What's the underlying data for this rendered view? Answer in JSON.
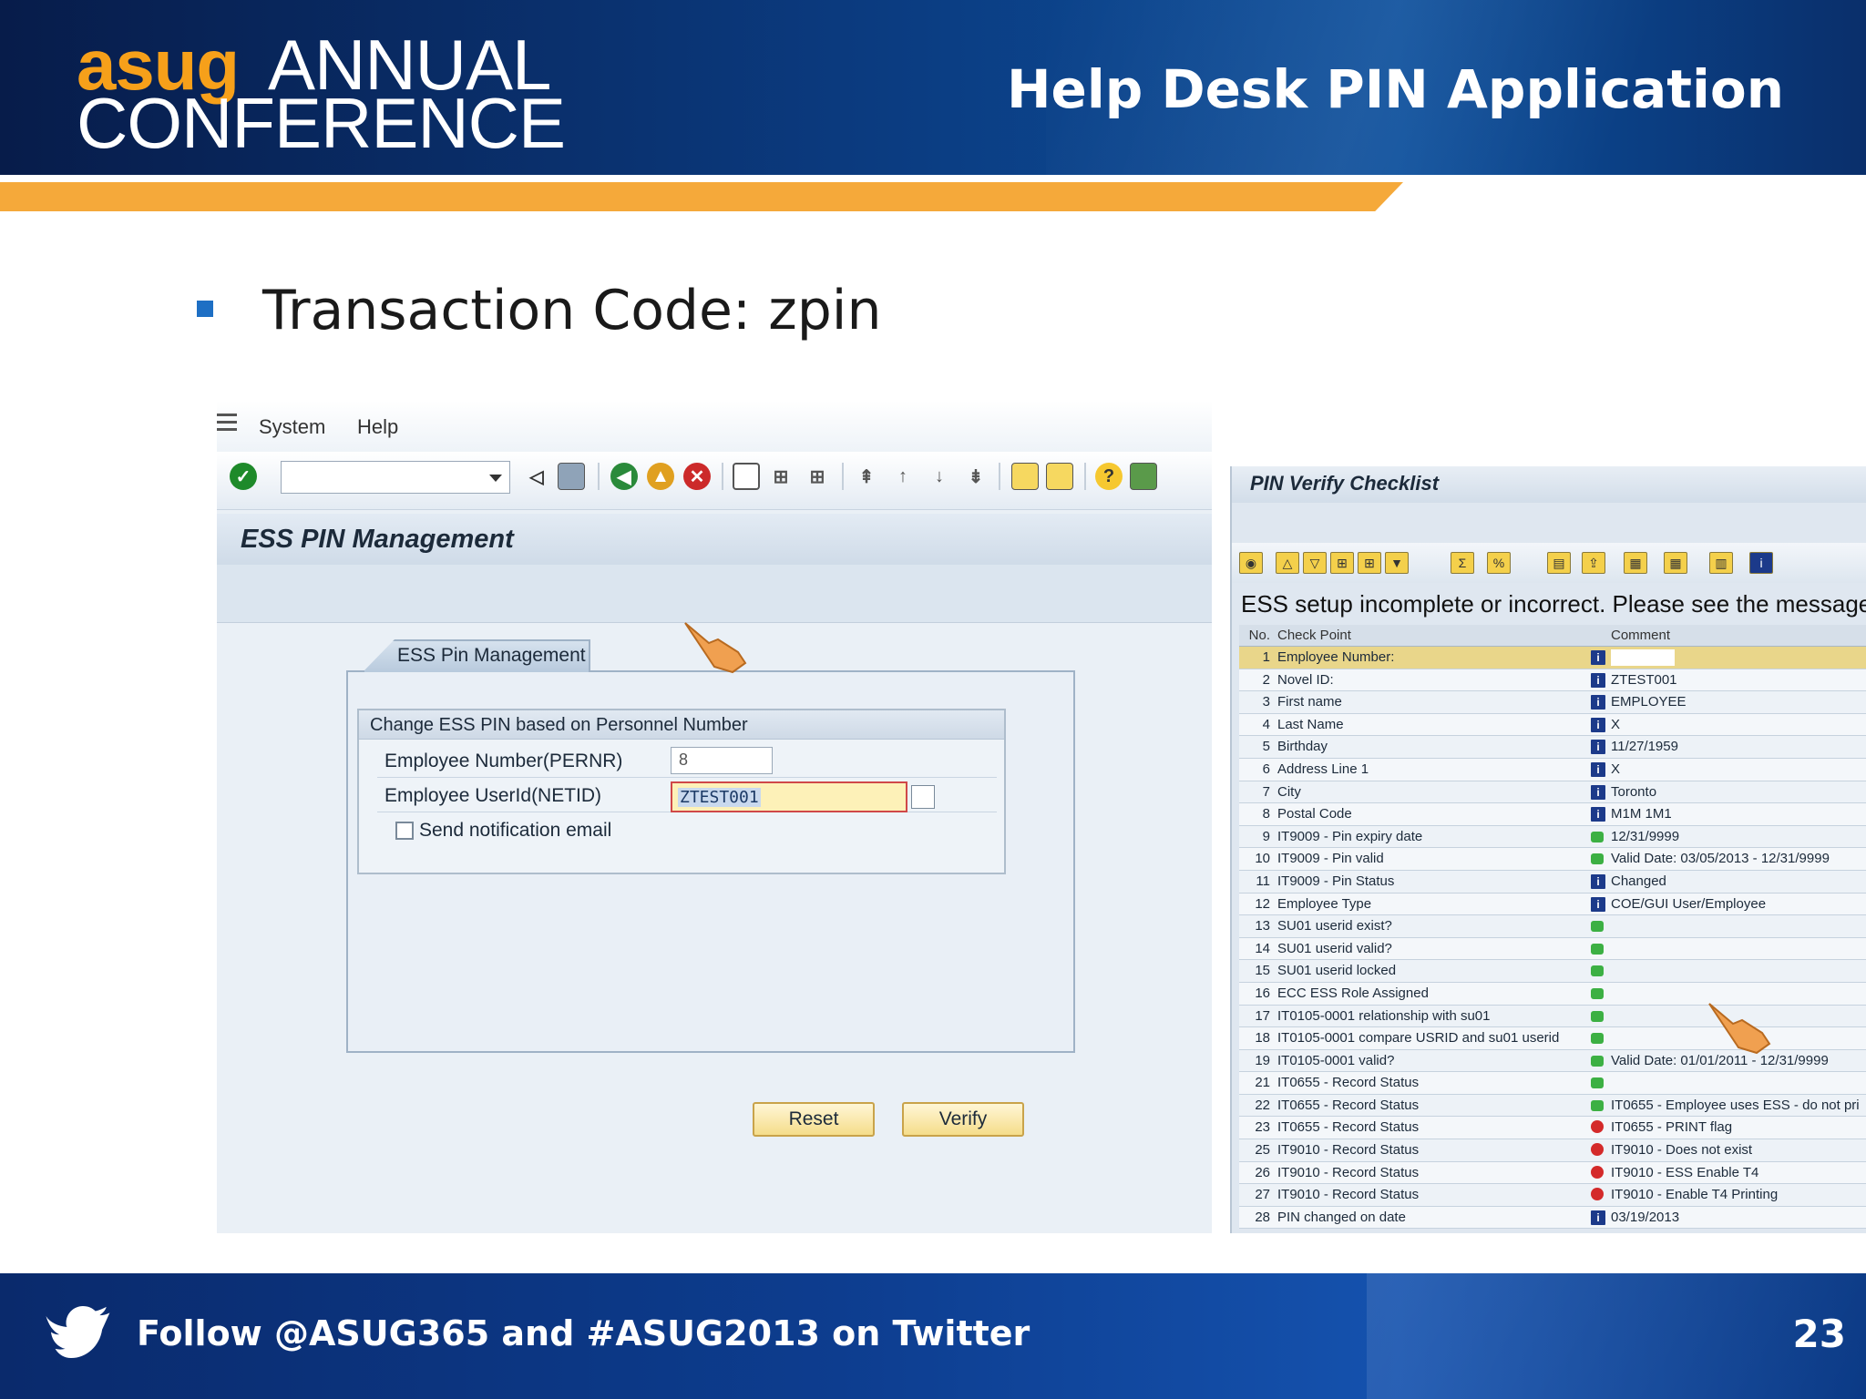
{
  "header": {
    "logo_line1_accent": "asug",
    "logo_line1_rest": "ANNUAL",
    "logo_line2": "CONFERENCE",
    "title": "Help Desk PIN Application"
  },
  "bullet": {
    "text": "Transaction Code: zpin"
  },
  "sap_left": {
    "menu": [
      "System",
      "Help"
    ],
    "title": "ESS PIN Management",
    "tab_label": "ESS Pin Management",
    "group_title": "Change ESS PIN based on Personnel Number",
    "fields": {
      "pernr_label": "Employee Number(PERNR)",
      "pernr_value": "8",
      "netid_label": "Employee UserId(NETID)",
      "netid_value": "ZTEST001",
      "notify_label": "Send notification email"
    },
    "buttons": {
      "reset": "Reset",
      "verify": "Verify"
    }
  },
  "sap_right": {
    "title": "PIN Verify Checklist",
    "message": "ESS setup incomplete or incorrect.  Please see the message",
    "columns": {
      "no": "No.",
      "check_point": "Check Point",
      "comment": "Comment"
    },
    "rows": [
      {
        "no": "1",
        "check": "Employee Number:",
        "status": "info",
        "comment": ""
      },
      {
        "no": "2",
        "check": "Novel ID:",
        "status": "info",
        "comment": "ZTEST001"
      },
      {
        "no": "3",
        "check": "First name",
        "status": "info",
        "comment": "EMPLOYEE"
      },
      {
        "no": "4",
        "check": "Last Name",
        "status": "info",
        "comment": "X"
      },
      {
        "no": "5",
        "check": "Birthday",
        "status": "info",
        "comment": "11/27/1959"
      },
      {
        "no": "6",
        "check": "Address Line 1",
        "status": "info",
        "comment": "X"
      },
      {
        "no": "7",
        "check": "City",
        "status": "info",
        "comment": "Toronto"
      },
      {
        "no": "8",
        "check": "Postal Code",
        "status": "info",
        "comment": "M1M 1M1"
      },
      {
        "no": "9",
        "check": "IT9009 - Pin expiry date",
        "status": "green",
        "comment": "12/31/9999"
      },
      {
        "no": "10",
        "check": "IT9009 - Pin valid",
        "status": "green",
        "comment": "Valid Date: 03/05/2013 - 12/31/9999"
      },
      {
        "no": "11",
        "check": "IT9009 - Pin Status",
        "status": "info",
        "comment": "Changed"
      },
      {
        "no": "12",
        "check": "Employee Type",
        "status": "info",
        "comment": "COE/GUI User/Employee"
      },
      {
        "no": "13",
        "check": "SU01 userid exist?",
        "status": "green",
        "comment": ""
      },
      {
        "no": "14",
        "check": "SU01 userid valid?",
        "status": "green",
        "comment": ""
      },
      {
        "no": "15",
        "check": "SU01 userid locked",
        "status": "green",
        "comment": ""
      },
      {
        "no": "16",
        "check": "ECC ESS Role Assigned",
        "status": "green",
        "comment": ""
      },
      {
        "no": "17",
        "check": "IT0105-0001 relationship with su01",
        "status": "green",
        "comment": ""
      },
      {
        "no": "18",
        "check": "IT0105-0001 compare USRID and su01 userid",
        "status": "green",
        "comment": ""
      },
      {
        "no": "19",
        "check": "IT0105-0001 valid?",
        "status": "green",
        "comment": "Valid Date: 01/01/2011 - 12/31/9999"
      },
      {
        "no": "21",
        "check": "IT0655 - Record Status",
        "status": "green",
        "comment": ""
      },
      {
        "no": "22",
        "check": "IT0655 - Record Status",
        "status": "green",
        "comment": "IT0655 - Employee uses ESS - do not pri"
      },
      {
        "no": "23",
        "check": "IT0655 - Record Status",
        "status": "red",
        "comment": "IT0655 - PRINT flag"
      },
      {
        "no": "25",
        "check": "IT9010 - Record Status",
        "status": "red",
        "comment": "IT9010 - Does not exist"
      },
      {
        "no": "26",
        "check": "IT9010 - Record Status",
        "status": "red",
        "comment": "IT9010 - ESS Enable T4"
      },
      {
        "no": "27",
        "check": "IT9010 - Record Status",
        "status": "red",
        "comment": "IT9010 - Enable T4 Printing"
      },
      {
        "no": "28",
        "check": "PIN changed on date",
        "status": "info",
        "comment": "03/19/2013"
      }
    ]
  },
  "footer": {
    "text": "Follow @ASUG365 and #ASUG2013 on Twitter",
    "page_number": "23"
  },
  "colors": {
    "header_navy": "#0b3a7e",
    "accent_orange": "#f5a93a",
    "bullet_blue": "#1e6fc4",
    "status_green": "#3cb043",
    "status_red": "#d42a2a",
    "info_blue": "#1c3a8a"
  }
}
